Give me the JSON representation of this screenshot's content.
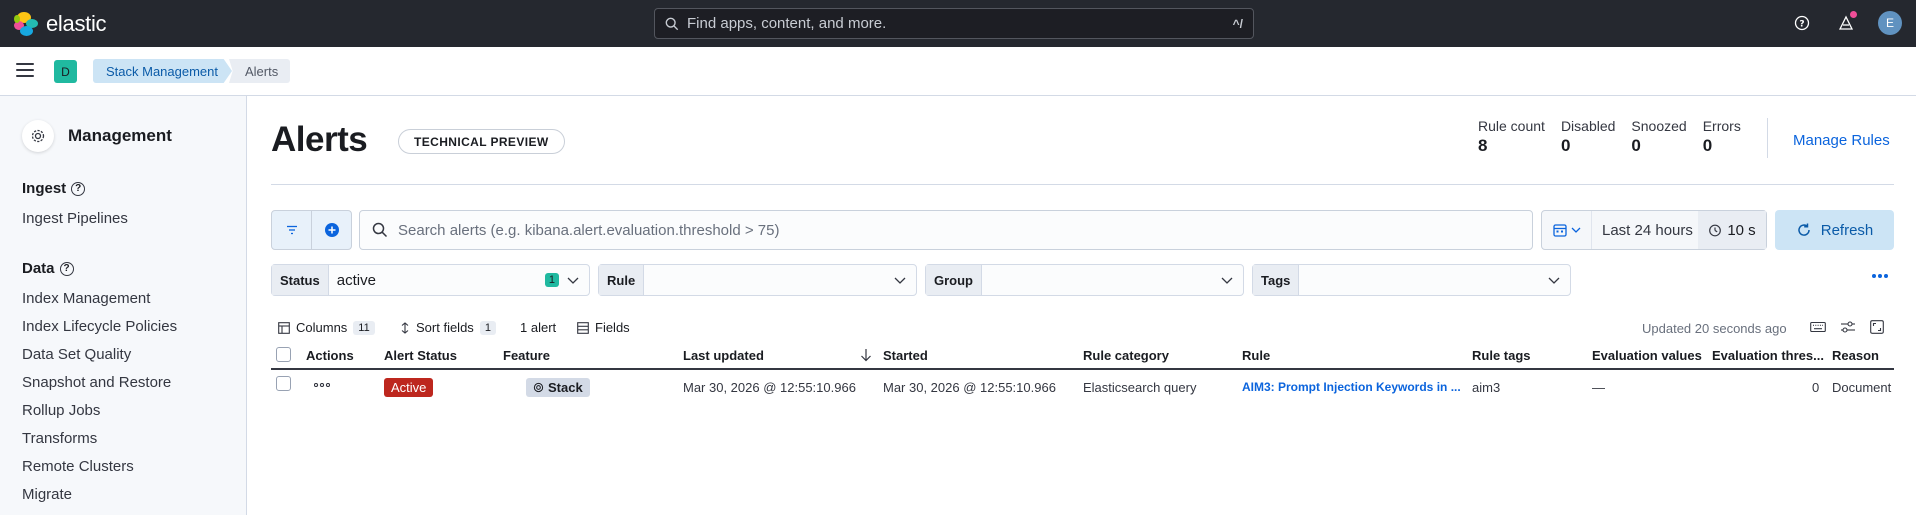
{
  "header": {
    "logo_text": "elastic",
    "search_placeholder": "Find apps, content, and more.",
    "search_shortcut": "^/",
    "avatar_initial": "E"
  },
  "breadcrumbs": {
    "space_initial": "D",
    "items": [
      "Stack Management",
      "Alerts"
    ]
  },
  "sidebar": {
    "title": "Management",
    "sections": [
      {
        "label": "Ingest",
        "items": [
          "Ingest Pipelines"
        ]
      },
      {
        "label": "Data",
        "items": [
          "Index Management",
          "Index Lifecycle Policies",
          "Data Set Quality",
          "Snapshot and Restore",
          "Rollup Jobs",
          "Transforms",
          "Remote Clusters",
          "Migrate"
        ]
      }
    ]
  },
  "page": {
    "title": "Alerts",
    "badge": "TECHNICAL PREVIEW",
    "stats": [
      {
        "label": "Rule count",
        "value": "8"
      },
      {
        "label": "Disabled",
        "value": "0"
      },
      {
        "label": "Snoozed",
        "value": "0"
      },
      {
        "label": "Errors",
        "value": "0"
      }
    ],
    "manage_rules": "Manage Rules"
  },
  "search": {
    "placeholder": "Search alerts (e.g. kibana.alert.evaluation.threshold > 75)",
    "date_range": "Last 24 hours",
    "refresh_interval": "10 s",
    "refresh_label": "Refresh"
  },
  "filters": [
    {
      "label": "Status",
      "value": "active",
      "count": "1"
    },
    {
      "label": "Rule",
      "value": ""
    },
    {
      "label": "Group",
      "value": ""
    },
    {
      "label": "Tags",
      "value": ""
    }
  ],
  "grid_toolbar": {
    "columns_label": "Columns",
    "columns_count": "11",
    "sort_label": "Sort fields",
    "sort_count": "1",
    "alert_count": "1 alert",
    "fields_label": "Fields",
    "updated": "Updated 20 seconds ago"
  },
  "table": {
    "columns": [
      "Actions",
      "Alert Status",
      "Feature",
      "Last updated",
      "Started",
      "Rule category",
      "Rule",
      "Rule tags",
      "Evaluation values",
      "Evaluation thres...",
      "Reason"
    ],
    "rows": [
      {
        "status": "Active",
        "feature": "Stack",
        "last_updated": "Mar 30, 2026 @ 12:55:10.966",
        "started": "Mar 30, 2026 @ 12:55:10.966",
        "rule_category": "Elasticsearch query",
        "rule": "AIM3: Prompt Injection Keywords in ...",
        "rule_tags": "aim3",
        "evaluation_values": "—",
        "evaluation_threshold": "0",
        "reason": "Document"
      }
    ]
  },
  "colors": {
    "accent": "#0b64dd",
    "active_status": "#bd271e",
    "space_badge": "#20b9a0",
    "header_bg": "#25282f"
  }
}
